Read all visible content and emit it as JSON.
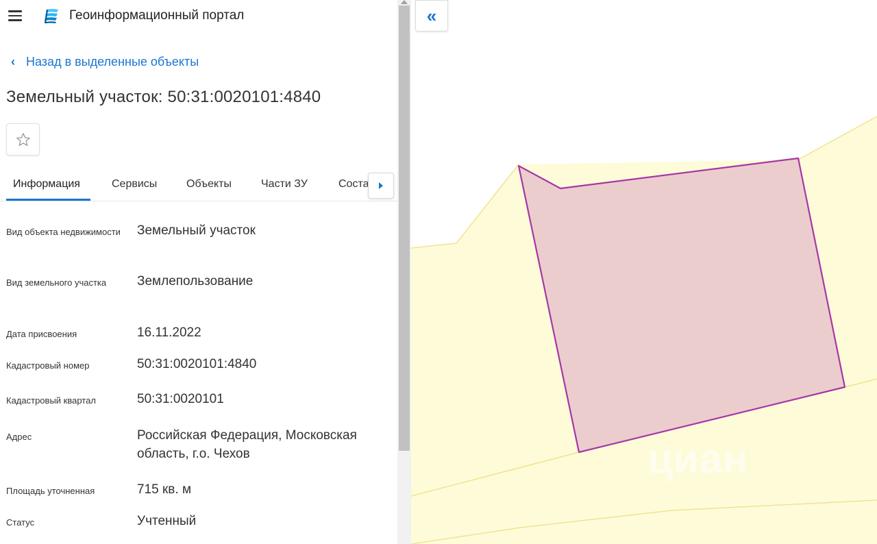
{
  "header": {
    "app_title": "Геоинформационный портал",
    "menu_icon": "hamburger-menu-icon",
    "logo_icon": "portal-logo-icon"
  },
  "navigation": {
    "back_label": "Назад в выделенные объекты"
  },
  "object": {
    "title": "Земельный участок: 50:31:0020101:4840"
  },
  "tabs": [
    {
      "label": "Информация",
      "active": true
    },
    {
      "label": "Сервисы",
      "active": false
    },
    {
      "label": "Объекты",
      "active": false
    },
    {
      "label": "Части ЗУ",
      "active": false
    },
    {
      "label": "Соста",
      "active": false
    }
  ],
  "properties": [
    {
      "label": "Вид объекта недвижимости",
      "value": "Земельный участок"
    },
    {
      "label": "Вид земельного участка",
      "value": "Землепользование"
    },
    {
      "label": "Дата присвоения",
      "value": "16.11.2022"
    },
    {
      "label": "Кадастровый номер",
      "value": "50:31:0020101:4840"
    },
    {
      "label": "Кадастровый квартал",
      "value": "50:31:0020101"
    },
    {
      "label": "Адрес",
      "value": "Российская Федерация, Московская область, г.о. Чехов"
    },
    {
      "label": "Площадь уточненная",
      "value": "715 кв. м"
    },
    {
      "label": "Статус",
      "value": "Учтенный"
    }
  ],
  "map": {
    "collapse_label": "«",
    "watermark": "циан",
    "colors": {
      "parcel_fill": "#ebcdcd",
      "parcel_stroke": "#a736a6",
      "background_fill": "#fefbd9",
      "background_stroke": "#efe48f"
    }
  },
  "colors": {
    "accent": "#1976d2"
  }
}
